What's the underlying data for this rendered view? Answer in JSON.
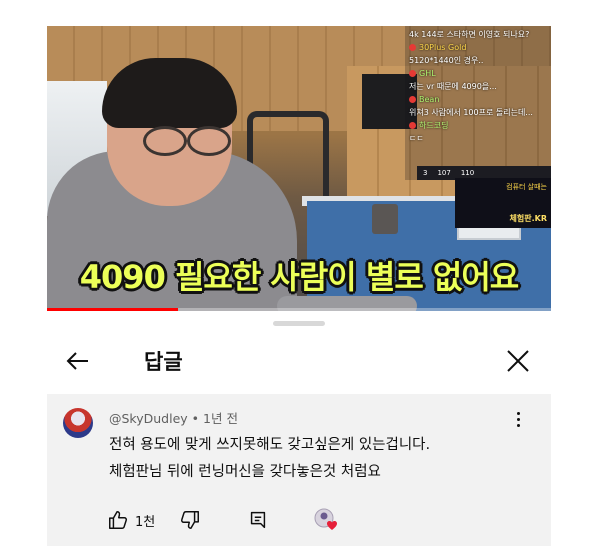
{
  "video": {
    "subtitle": "4090 필요한 사람이 별로 없어요",
    "progress_fraction": 0.26,
    "chat": [
      {
        "text": "4k 144로 스타하면 이영호 되나요?",
        "style": "white"
      },
      {
        "text": "30Plus Gold",
        "style": "gold"
      },
      {
        "text": "5120*1440인 경우..",
        "style": "white"
      },
      {
        "text": "GHL",
        "style": "green"
      },
      {
        "text": "저는 vr 때문에 4090을...",
        "style": "white"
      },
      {
        "text": "Bean",
        "style": "green"
      },
      {
        "text": "위쳐3 사람에서 100프로 돌리는데...",
        "style": "white"
      },
      {
        "text": "하드코딩",
        "style": "green"
      },
      {
        "text": "ㄷㄷ",
        "style": "white"
      }
    ],
    "counters": [
      "3",
      "107",
      "110"
    ],
    "promo": {
      "line1": "컴퓨터 살때는",
      "line2": "체험판.KR"
    }
  },
  "sheet": {
    "title": "답글"
  },
  "comment": {
    "author": "@SkyDudley",
    "time": "1년 전",
    "lines": [
      "전혀 용도에 맞게 쓰지못해도 갖고싶은게 있는겁니다.",
      "체험판님 뒤에 런닝머신을 갖다놓은것 처럼요"
    ],
    "likes": "1천"
  },
  "icons": {
    "back": "arrow-left-icon",
    "close": "close-icon",
    "more": "more-vert-icon",
    "like": "thumb-up-icon",
    "dislike": "thumb-down-icon",
    "reply": "reply-comment-icon",
    "heart": "creator-heart-icon"
  },
  "colors": {
    "subtitle": "#ecff58",
    "progress": "#ff0000",
    "comment_bg": "#f2f2f2"
  }
}
